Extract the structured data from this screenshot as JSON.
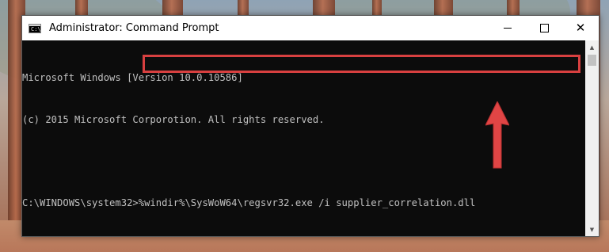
{
  "window": {
    "title": "Administrator: Command Prompt",
    "icon": "command-prompt-icon",
    "icon_glyph": "C:\\",
    "controls": {
      "minimize": "minimize-icon",
      "maximize": "maximize-icon",
      "close": "close-icon",
      "close_glyph": "✕"
    }
  },
  "console": {
    "lines": [
      "Microsoft Windows [Version 10.0.10586]",
      "(c) 2015 Microsoft Corporotion. All rights reserved.",
      "",
      "C:\\WINDOWS\\system32>%windir%\\SysWoW64\\regsvr32.exe /i supplier_correlation.dll"
    ]
  },
  "scrollbar": {
    "up_glyph": "▲",
    "down_glyph": "▼"
  },
  "highlight": {
    "color": "#d84040"
  },
  "colors": {
    "console_bg": "#0c0c0c",
    "console_text": "#c0c0c0",
    "arrow": "#e04545"
  }
}
